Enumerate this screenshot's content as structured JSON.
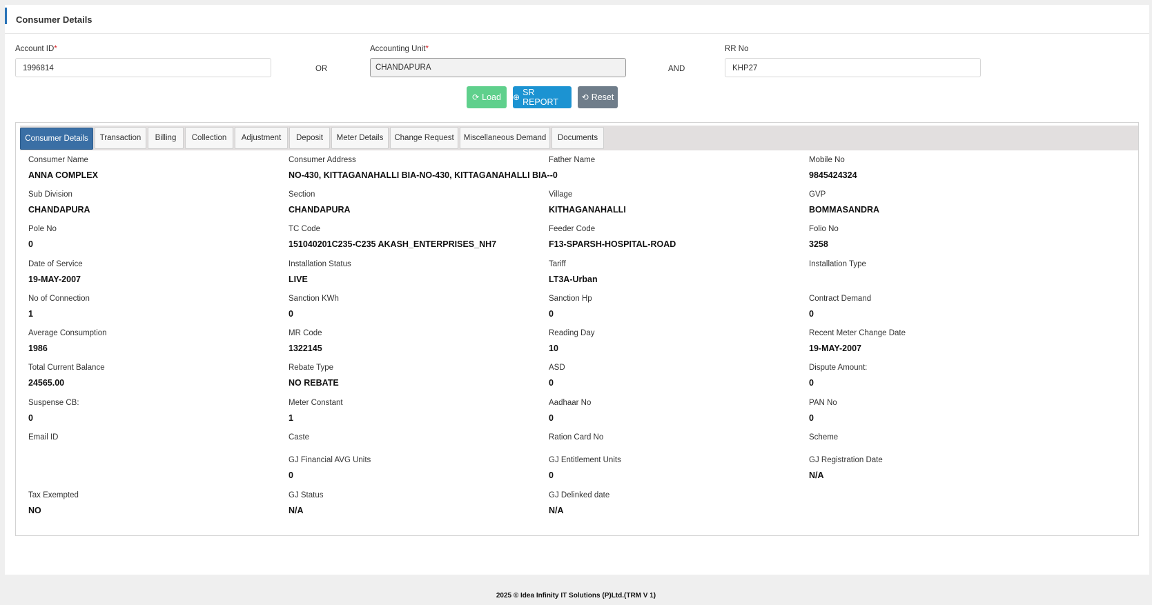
{
  "header": {
    "title": "Consumer Details"
  },
  "search": {
    "account_id": {
      "label": "Account ID",
      "required": "*",
      "value": "1996814"
    },
    "or_label": "OR",
    "accounting_unit": {
      "label": "Accounting Unit",
      "required": "*",
      "value": "CHANDAPURA"
    },
    "and_label": "AND",
    "rr_no": {
      "label": "RR No",
      "value": "KHP27"
    }
  },
  "buttons": {
    "load": "Load",
    "sr_report": "SR REPORT",
    "reset": "Reset"
  },
  "tabs": [
    "Consumer Details",
    "Transaction",
    "Billing",
    "Collection",
    "Adjustment",
    "Deposit",
    "Meter Details",
    "Change Request",
    "Miscellaneous Demand",
    "Documents"
  ],
  "fields": [
    {
      "label": "Consumer Name",
      "value": "ANNA COMPLEX"
    },
    {
      "label": "Consumer Address",
      "value": "NO-430, KITTAGANAHALLI BIA-NO-430, KITTAGANAHALLI BIA--0"
    },
    {
      "label": "Father Name",
      "value": ""
    },
    {
      "label": "Mobile No",
      "value": "9845424324"
    },
    {
      "label": "Sub Division",
      "value": "CHANDAPURA"
    },
    {
      "label": "Section",
      "value": "CHANDAPURA"
    },
    {
      "label": "Village",
      "value": "KITHAGANAHALLI"
    },
    {
      "label": "GVP",
      "value": "BOMMASANDRA"
    },
    {
      "label": "Pole No",
      "value": "0"
    },
    {
      "label": "TC Code",
      "value": "151040201C235-C235 AKASH_ENTERPRISES_NH7"
    },
    {
      "label": "Feeder Code",
      "value": "F13-SPARSH-HOSPITAL-ROAD"
    },
    {
      "label": "Folio No",
      "value": "3258"
    },
    {
      "label": "Date of Service",
      "value": "19-MAY-2007"
    },
    {
      "label": "Installation Status",
      "value": "LIVE"
    },
    {
      "label": "Tariff",
      "value": "LT3A-Urban"
    },
    {
      "label": "Installation Type",
      "value": ""
    },
    {
      "label": "No of Connection",
      "value": "1"
    },
    {
      "label": "Sanction KWh",
      "value": "0"
    },
    {
      "label": "Sanction Hp",
      "value": "0"
    },
    {
      "label": "Contract Demand",
      "value": "0"
    },
    {
      "label": "Average Consumption",
      "value": "1986"
    },
    {
      "label": "MR Code",
      "value": "1322145"
    },
    {
      "label": "Reading Day",
      "value": "10"
    },
    {
      "label": "Recent Meter Change Date",
      "value": "19-MAY-2007"
    },
    {
      "label": "Total Current Balance",
      "value": "24565.00"
    },
    {
      "label": "Rebate Type",
      "value": "NO REBATE"
    },
    {
      "label": "ASD",
      "value": "0"
    },
    {
      "label": "Dispute Amount:",
      "value": "0"
    },
    {
      "label": "Suspense CB:",
      "value": "0"
    },
    {
      "label": "Meter Constant",
      "value": "1"
    },
    {
      "label": "Aadhaar No",
      "value": "0"
    },
    {
      "label": "PAN No",
      "value": "0"
    },
    {
      "label": "Email ID",
      "value": ""
    },
    {
      "label": "Caste",
      "value": ""
    },
    {
      "label": "Ration Card No",
      "value": ""
    },
    {
      "label": "Scheme",
      "value": ""
    },
    {
      "label": "",
      "value": ""
    },
    {
      "label": "GJ Financial AVG Units",
      "value": "0"
    },
    {
      "label": "GJ Entitlement Units",
      "value": "0"
    },
    {
      "label": "GJ Registration Date",
      "value": "N/A"
    },
    {
      "label": "Tax Exempted",
      "value": "NO"
    },
    {
      "label": "GJ Status",
      "value": "N/A"
    },
    {
      "label": "GJ Delinked date",
      "value": "N/A"
    }
  ],
  "footer": {
    "text": "2025 © Idea Infinity IT Solutions (P)Ltd.(TRM V 1)"
  }
}
